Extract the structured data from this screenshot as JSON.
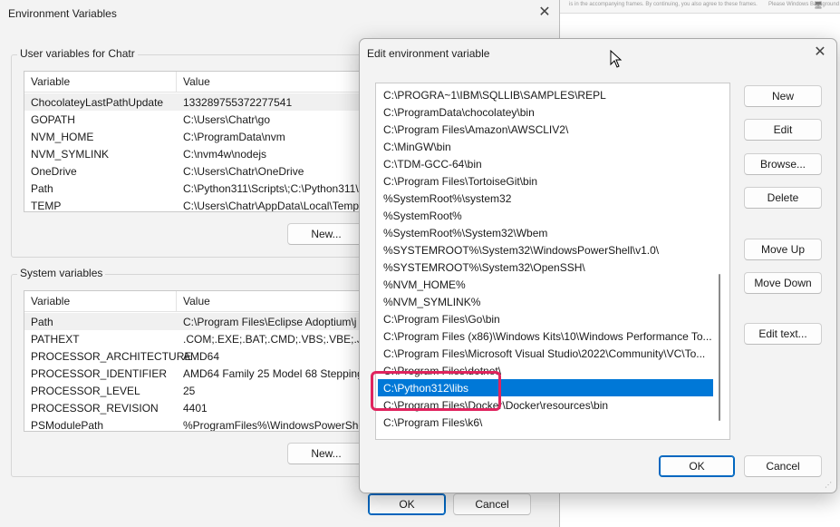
{
  "background": {
    "strip_text_left": "is in the accompanying frames. By continuing, you also agree to these frames.",
    "strip_text_right": "Please Windows Background"
  },
  "main_window": {
    "title": "Environment Variables",
    "user_group_label": "User variables for Chatr",
    "user_headers": [
      "Variable",
      "Value"
    ],
    "user_rows": [
      {
        "variable": "ChocolateyLastPathUpdate",
        "value": "133289755372277541"
      },
      {
        "variable": "GOPATH",
        "value": "C:\\Users\\Chatr\\go"
      },
      {
        "variable": "NVM_HOME",
        "value": "C:\\ProgramData\\nvm"
      },
      {
        "variable": "NVM_SYMLINK",
        "value": "C:\\nvm4w\\nodejs"
      },
      {
        "variable": "OneDrive",
        "value": "C:\\Users\\Chatr\\OneDrive"
      },
      {
        "variable": "Path",
        "value": "C:\\Python311\\Scripts\\;C:\\Python311\\"
      },
      {
        "variable": "TEMP",
        "value": "C:\\Users\\Chatr\\AppData\\Local\\Temp"
      }
    ],
    "user_new_label": "New...",
    "system_group_label": "System variables",
    "system_headers": [
      "Variable",
      "Value"
    ],
    "system_rows": [
      {
        "variable": "Path",
        "value": "C:\\Program Files\\Eclipse Adoptium\\j"
      },
      {
        "variable": "PATHEXT",
        "value": ".COM;.EXE;.BAT;.CMD;.VBS;.VBE;.JS;.J"
      },
      {
        "variable": "PROCESSOR_ARCHITECTURE",
        "value": "AMD64"
      },
      {
        "variable": "PROCESSOR_IDENTIFIER",
        "value": "AMD64 Family 25 Model 68 Stepping"
      },
      {
        "variable": "PROCESSOR_LEVEL",
        "value": "25"
      },
      {
        "variable": "PROCESSOR_REVISION",
        "value": "4401"
      },
      {
        "variable": "PSModulePath",
        "value": "%ProgramFiles%\\WindowsPowerShe"
      }
    ],
    "system_new_label": "New...",
    "ok_label": "OK",
    "cancel_label": "Cancel"
  },
  "edit_dialog": {
    "title": "Edit environment variable",
    "entries": [
      "C:\\PROGRA~1\\IBM\\SQLLIB\\SAMPLES\\REPL",
      "C:\\ProgramData\\chocolatey\\bin",
      "C:\\Program Files\\Amazon\\AWSCLIV2\\",
      "C:\\MinGW\\bin",
      "C:\\TDM-GCC-64\\bin",
      "C:\\Program Files\\TortoiseGit\\bin",
      "%SystemRoot%\\system32",
      "%SystemRoot%",
      "%SystemRoot%\\System32\\Wbem",
      "%SYSTEMROOT%\\System32\\WindowsPowerShell\\v1.0\\",
      "%SYSTEMROOT%\\System32\\OpenSSH\\",
      "%NVM_HOME%",
      "%NVM_SYMLINK%",
      "C:\\Program Files\\Go\\bin",
      "C:\\Program Files (x86)\\Windows Kits\\10\\Windows Performance To...",
      "C:\\Program Files\\Microsoft Visual Studio\\2022\\Community\\VC\\To...",
      "C:\\Program Files\\dotnet\\",
      "C:\\Python312\\libs",
      "C:\\Program Files\\Docker\\Docker\\resources\\bin",
      "C:\\Program Files\\k6\\"
    ],
    "selected_entry": "C:\\Python312\\libs",
    "buttons": {
      "new": "New",
      "edit": "Edit",
      "browse": "Browse...",
      "delete": "Delete",
      "move_up": "Move Up",
      "move_down": "Move Down",
      "edit_text": "Edit text..."
    },
    "ok_label": "OK",
    "cancel_label": "Cancel"
  },
  "colors": {
    "selection": "#0078d7",
    "highlight_annotation": "#e0245e",
    "primary_border": "#0067c0"
  }
}
